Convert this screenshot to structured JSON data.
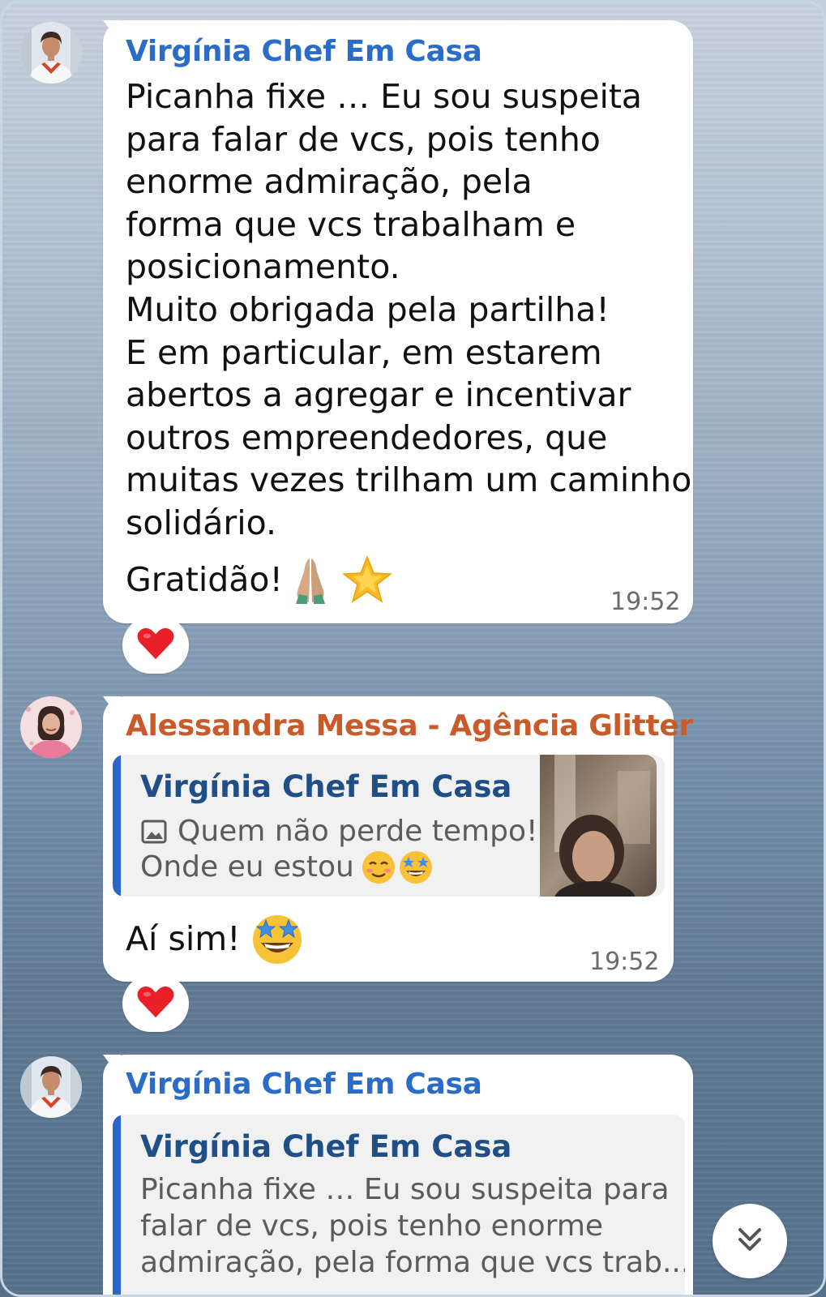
{
  "colors": {
    "sender_virginia": "#2a6cc8",
    "sender_alessandra": "#c95a2a",
    "reply_accent": "#2a66c9",
    "bubble": "#ffffff"
  },
  "messages": [
    {
      "sender": "Virgínia Chef Em Casa",
      "avatar": "chef-avatar-icon",
      "text": "Picanha fixe … Eu sou suspeita\npara falar de vcs, pois tenho\nenorme admiração, pela\nforma que vcs trabalham e\nposicionamento.\nMuito obrigada pela partilha!\nE em particular, em estarem\nabertos a agregar e incentivar\noutros empreendedores, que\nmuitas vezes trilham um caminho\nsolidário.",
      "closing": "Gratidão!",
      "closing_emoji": [
        "folded-hands-icon",
        "star-icon"
      ],
      "time": "19:52",
      "reaction": "heart-icon"
    },
    {
      "sender": "Alessandra Messa - Agência Glitter",
      "avatar": "woman-avatar-icon",
      "reply": {
        "name": "Virgínia Chef Em Casa",
        "line1": "Quem não perde tempo!?",
        "line2": "Onde eu estou",
        "media_icon": "image-icon",
        "emoji": [
          "smiling-face-icon",
          "star-struck-icon"
        ],
        "thumbnail": "photo-thumbnail"
      },
      "text": "Aí sim!",
      "emoji": "star-struck-icon",
      "time": "19:52",
      "reaction": "heart-icon"
    },
    {
      "sender": "Virgínia Chef Em Casa",
      "avatar": "chef-avatar-icon",
      "reply": {
        "name": "Virgínia Chef Em Casa",
        "line1": "Picanha fixe … Eu sou suspeita para",
        "line2": "falar de vcs, pois tenho enorme",
        "line3": "admiração, pela forma que vcs trab..."
      }
    }
  ],
  "scroll_button": "double-chevron-down-icon"
}
